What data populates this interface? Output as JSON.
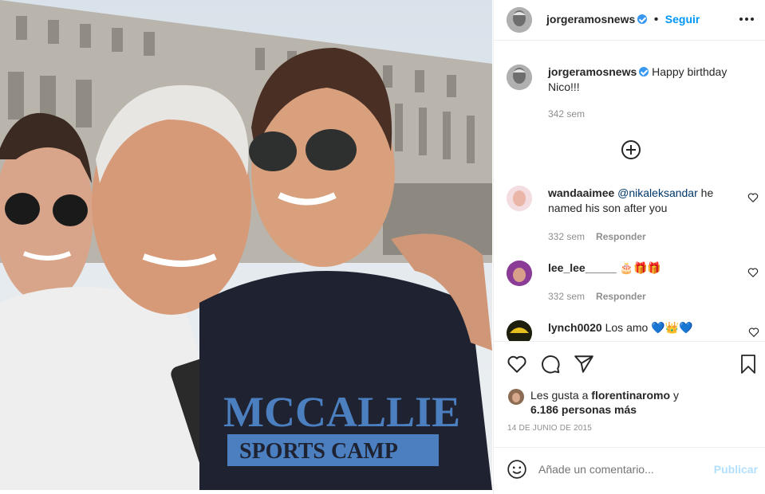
{
  "post": {
    "author": "jorgeramosnews",
    "follow_label": "Seguir",
    "more_icon": "more-options-icon"
  },
  "caption": {
    "username": "jorgeramosnews",
    "text": "Happy birthday Nico!!!",
    "time": "342 sem"
  },
  "load_more_icon": "plus-circle-icon",
  "comments": [
    {
      "username": "wandaaimee",
      "mention": "@nikaleksandar",
      "text": " he named his son after you",
      "time": "332 sem",
      "reply_label": "Responder"
    },
    {
      "username": "lee_lee_____",
      "text": "🎂🎁🎁",
      "time": "332 sem",
      "reply_label": "Responder"
    },
    {
      "username": "lynch0020",
      "text": "Los amo 💙👑💙"
    }
  ],
  "likes": {
    "prefix": "Les gusta a",
    "user": "florentinaromo",
    "conj": "y",
    "others": "6.186 personas más"
  },
  "date": "14 DE JUNIO DE 2015",
  "add_comment": {
    "placeholder": "Añade un comentario...",
    "post_label": "Publicar"
  },
  "photo": {
    "shirt_line1": "MCCALLIE",
    "shirt_line2": "SPORTS CAMP"
  },
  "colors": {
    "accent": "#0095f6",
    "text": "#262626",
    "muted": "#8e8e8e"
  }
}
